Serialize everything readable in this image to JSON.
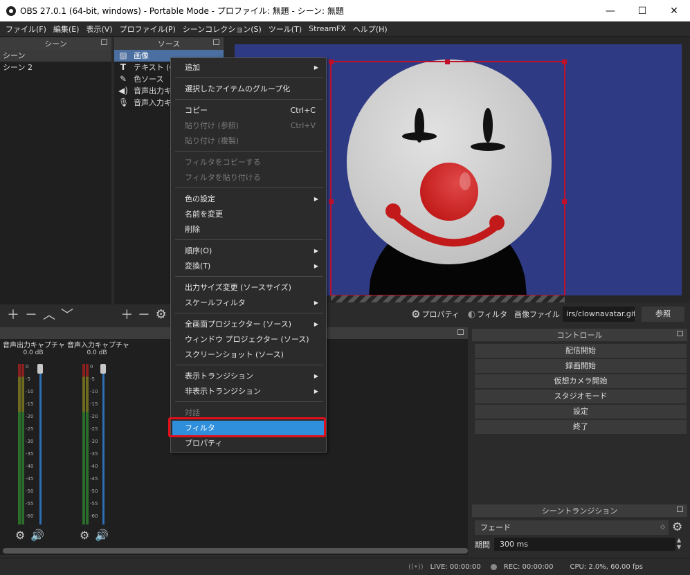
{
  "window": {
    "title": "OBS 27.0.1 (64-bit, windows) - Portable Mode - プロファイル: 無題 - シーン: 無題",
    "controls": [
      "—",
      "☐",
      "✕"
    ]
  },
  "menubar": [
    "ファイル(F)",
    "編集(E)",
    "表示(V)",
    "プロファイル(P)",
    "シーンコレクション(S)",
    "ツール(T)",
    "StreamFX",
    "ヘルプ(H)"
  ],
  "scenes": {
    "title": "シーン",
    "items": [
      "シーン",
      "シーン 2"
    ]
  },
  "sources": {
    "title": "ソース",
    "items": [
      {
        "label": "画像",
        "icon": "image-icon"
      },
      {
        "label": "テキスト (G",
        "icon": "text-icon"
      },
      {
        "label": "色ソース",
        "icon": "brush-icon"
      },
      {
        "label": "音声出力キ",
        "icon": "speaker-icon"
      },
      {
        "label": "音声入力キ",
        "icon": "mic-icon"
      }
    ]
  },
  "properties_bar": {
    "properties": "プロパティ",
    "filters": "フィルタ",
    "file_label": "画像ファイル",
    "file_path": "irs/clownavatar.gif",
    "browse": "参照"
  },
  "mixer": {
    "channels": [
      {
        "name": "音声出力キャプチャ",
        "db": "0.0 dB"
      },
      {
        "name": "音声入力キャプチャ",
        "db": "0.0 dB"
      }
    ],
    "scale": [
      "0",
      "-5",
      "-10",
      "-15",
      "-20",
      "-25",
      "-30",
      "-35",
      "-40",
      "-45",
      "-50",
      "-55",
      "-60"
    ]
  },
  "controls": {
    "title": "コントロール",
    "buttons": [
      "配信開始",
      "録画開始",
      "仮想カメラ開始",
      "スタジオモード",
      "設定",
      "終了"
    ]
  },
  "transitions": {
    "title": "シーントランジション",
    "selected": "フェード",
    "duration_label": "期間",
    "duration_value": "300 ms"
  },
  "status": {
    "live": "LIVE: 00:00:00",
    "rec": "REC: 00:00:00",
    "cpu": "CPU: 2.0%, 60.00 fps"
  },
  "context_menu": {
    "add": "追加",
    "group": "選択したアイテムのグループ化",
    "copy": "コピー",
    "copy_shortcut": "Ctrl+C",
    "paste_ref": "貼り付け (参照)",
    "paste_ref_shortcut": "Ctrl+V",
    "paste_dup": "貼り付け (複製)",
    "copy_filters": "フィルタをコピーする",
    "paste_filters": "フィルタを貼り付ける",
    "color": "色の設定",
    "rename": "名前を変更",
    "delete": "削除",
    "order": "順序(O)",
    "transform": "変換(T)",
    "resize_output": "出力サイズ変更 (ソースサイズ)",
    "scale_filter": "スケールフィルタ",
    "fullscreen_projector": "全画面プロジェクター (ソース)",
    "window_projector": "ウィンドウ プロジェクター (ソース)",
    "screenshot": "スクリーンショット (ソース)",
    "show_transition": "表示トランジション",
    "hide_transition": "非表示トランジション",
    "interact": "対話",
    "filters": "フィルタ",
    "properties": "プロパティ"
  },
  "colors": {
    "canvas": "#2f3a85",
    "highlight": "#2f8fdc",
    "annotation": "#e0101b",
    "selection": "#c0102a"
  }
}
